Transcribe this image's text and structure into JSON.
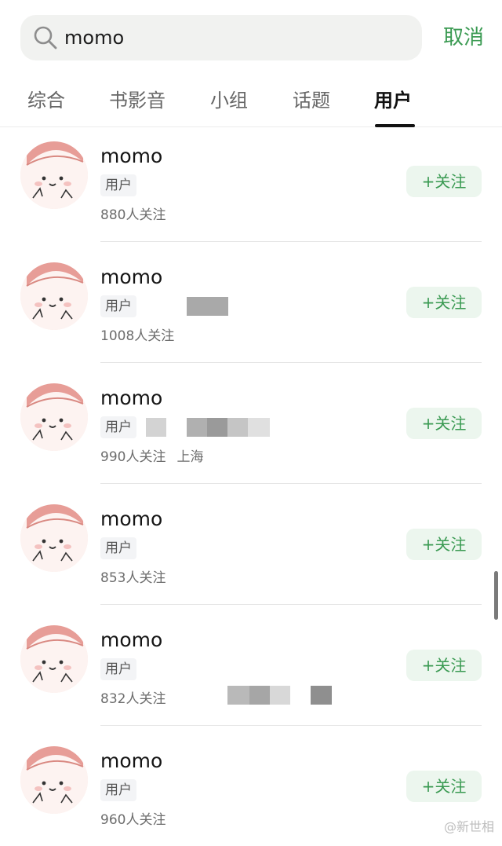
{
  "search": {
    "value": "momo",
    "cancel_label": "取消"
  },
  "tabs": [
    {
      "label": "综合"
    },
    {
      "label": "书影音"
    },
    {
      "label": "小组"
    },
    {
      "label": "话题"
    },
    {
      "label": "用户"
    }
  ],
  "active_tab": "用户",
  "results": [
    {
      "name": "momo",
      "tag": "用户",
      "followers": "880人关注",
      "location": "",
      "follow_label": "+关注"
    },
    {
      "name": "momo",
      "tag": "用户",
      "followers": "1008人关注",
      "location": "",
      "follow_label": "+关注"
    },
    {
      "name": "momo",
      "tag": "用户",
      "followers": "990人关注",
      "location": "上海",
      "follow_label": "+关注"
    },
    {
      "name": "momo",
      "tag": "用户",
      "followers": "853人关注",
      "location": "",
      "follow_label": "+关注"
    },
    {
      "name": "momo",
      "tag": "用户",
      "followers": "832人关注",
      "location": "",
      "follow_label": "+关注"
    },
    {
      "name": "momo",
      "tag": "用户",
      "followers": "960人关注",
      "location": "",
      "follow_label": "+关注"
    }
  ],
  "watermark": "@新世相",
  "colors": {
    "accent": "#3a9a52",
    "follow_bg": "#ecf6ee",
    "search_bg": "#f1f2f0"
  }
}
